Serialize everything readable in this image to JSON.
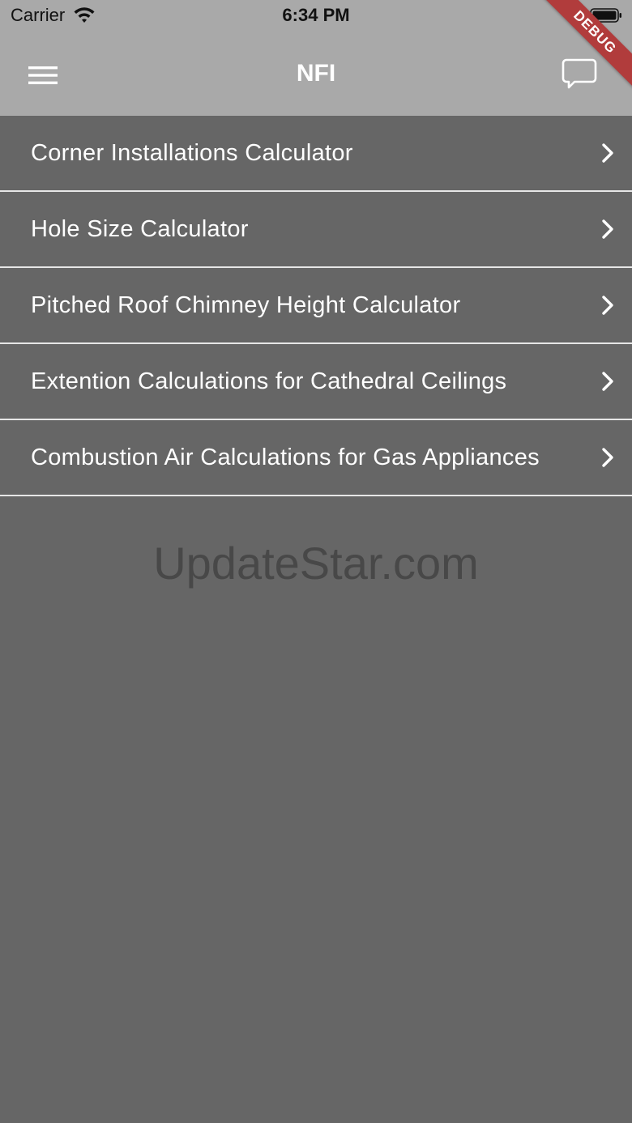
{
  "status_bar": {
    "carrier": "Carrier",
    "time": "6:34 PM",
    "wifi_icon": "wifi-icon",
    "battery_icon": "battery-icon"
  },
  "app_bar": {
    "title": "NFI",
    "menu_icon": "hamburger-menu-icon",
    "chat_icon": "chat-bubble-icon",
    "background": "#a9a9a9"
  },
  "debug_banner": "DEBUG",
  "menu_items": [
    {
      "label": "Corner Installations Calculator"
    },
    {
      "label": "Hole Size Calculator"
    },
    {
      "label": "Pitched Roof Chimney Height Calculator"
    },
    {
      "label": "Extention Calculations for Cathedral Ceilings"
    },
    {
      "label": "Combustion Air Calculations for Gas Appliances"
    }
  ],
  "watermark": "UpdateStar.com",
  "colors": {
    "body_background": "#666666",
    "divider": "#e6e6e6",
    "debug_ribbon": "#b13c3c"
  }
}
